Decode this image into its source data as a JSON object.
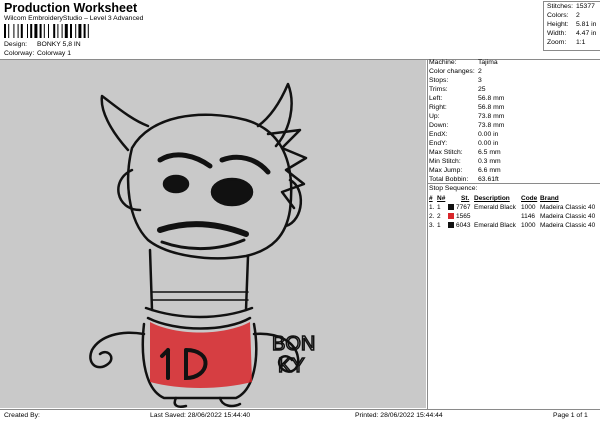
{
  "header": {
    "title": "Production Worksheet",
    "subtitle": "Wilcom EmbroideryStudio – Level 3 Advanced"
  },
  "meta": [
    {
      "label": "Design:",
      "value": "BONKY 5,8 IN"
    },
    {
      "label": "Colorway:",
      "value": "Colorway 1"
    }
  ],
  "summary": [
    {
      "label": "Stitches:",
      "value": "15377"
    },
    {
      "label": "Colors:",
      "value": "2"
    },
    {
      "label": "Height:",
      "value": "5.81 in"
    },
    {
      "label": "Width:",
      "value": "4.47 in"
    },
    {
      "label": "Zoom:",
      "value": "1:1"
    }
  ],
  "specs": [
    {
      "label": "Machine:",
      "value": "Tajima"
    },
    {
      "label": "Color changes:",
      "value": "2"
    },
    {
      "label": "Stops:",
      "value": "3"
    },
    {
      "label": "Trims:",
      "value": "25"
    },
    {
      "label": "Left:",
      "value": "56.8 mm"
    },
    {
      "label": "Right:",
      "value": "56.8 mm"
    },
    {
      "label": "Up:",
      "value": "73.8 mm"
    },
    {
      "label": "Down:",
      "value": "73.8 mm"
    },
    {
      "label": "EndX:",
      "value": "0.00 in"
    },
    {
      "label": "EndY:",
      "value": "0.00 in"
    },
    {
      "label": "Max Stitch:",
      "value": "6.5 mm"
    },
    {
      "label": "Min Stitch:",
      "value": "0.3 mm"
    },
    {
      "label": "Max Jump:",
      "value": "6.6 mm"
    },
    {
      "label": "Total Bobbin:",
      "value": "63.61ft"
    }
  ],
  "stop_sequence": {
    "title": "Stop Sequence:",
    "headers": {
      "num": "#",
      "n": "N#",
      "st": "St.",
      "description": "Description",
      "code": "Code",
      "brand": "Brand"
    },
    "rows": [
      {
        "num": "1.",
        "n": "1",
        "color": "#111111",
        "st": "7767",
        "description": "Emerald Black",
        "code": "1000",
        "brand": "Madeira Classic 40"
      },
      {
        "num": "2.",
        "n": "2",
        "color": "#d8262a",
        "st": "1565",
        "description": "",
        "code": "1146",
        "brand": "Madeira Classic 40"
      },
      {
        "num": "3.",
        "n": "1",
        "color": "#111111",
        "st": "6043",
        "description": "Emerald Black",
        "code": "1000",
        "brand": "Madeira Classic 40"
      }
    ]
  },
  "design_text": {
    "line1": "BON",
    "line2": "KY"
  },
  "footer": {
    "created": "Created By:",
    "saved": "Last Saved: 28/06/2022 15:44:40",
    "printed": "Printed: 28/06/2022 15:44:44",
    "page": "Page 1 of 1"
  },
  "colors": {
    "canvas": "#c9c9c9",
    "thread_black": "#111111",
    "thread_red": "#d8262a"
  }
}
